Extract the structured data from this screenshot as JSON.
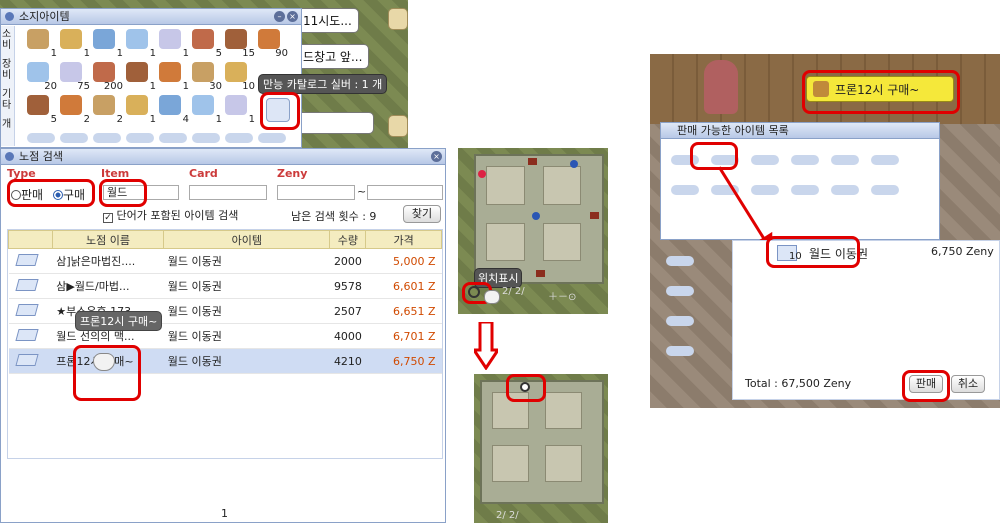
{
  "inventory": {
    "title": "소지아이템",
    "side_tabs": [
      "소비",
      "장비",
      "기타",
      "개"
    ],
    "row1_counts": [
      "1",
      "1",
      "1",
      "1",
      "1",
      "5",
      "15",
      "90"
    ],
    "row2_counts": [
      "20",
      "75",
      "200",
      "1",
      "1",
      "30",
      "10",
      ""
    ],
    "row3_counts": [
      "5",
      "2",
      "2",
      "1",
      "4",
      "1",
      "1",
      ""
    ],
    "tooltip": "만능 카탈로그 실버 : 1 개"
  },
  "bubbles": {
    "b1": "11시도...",
    "b2": "드창고 앞...",
    "b3": ""
  },
  "vending": {
    "title": "노점 검색",
    "labels": {
      "type": "Type",
      "item": "Item",
      "card": "Card",
      "zeny": "Zeny"
    },
    "radio_sell": "판매",
    "radio_buy": "구매",
    "item_value": "월드",
    "tilde": "~",
    "checkbox_label": "단어가 포함된 아이템 검색",
    "remaining": "남은 검색 횟수 : 9",
    "search_button": "찾기",
    "columns": [
      "노점 이름",
      "아이템",
      "수량",
      "가격"
    ],
    "rows": [
      {
        "shop": "삼]낡은마법진....",
        "item": "월드 이동권",
        "qty": "2000",
        "price": "5,000 Z"
      },
      {
        "shop": "삼▶월드/마법...",
        "item": "월드 이동권",
        "qty": "9578",
        "price": "6,601 Z"
      },
      {
        "shop": "★부스유후 173",
        "item": "월드 이동권",
        "qty": "2507",
        "price": "6,651 Z"
      },
      {
        "shop": "월드 선의의 맥...",
        "item": "월드 이동권",
        "qty": "4000",
        "price": "6,701 Z"
      },
      {
        "shop": "프론12시 구매~",
        "item": "월드 이동권",
        "qty": "4210",
        "price": "6,750 Z"
      }
    ],
    "row_tooltip": "프론12시 구매~",
    "page": "1"
  },
  "minimap": {
    "position_label": "위치표시",
    "coords": "2/ 2/"
  },
  "shop": {
    "sign": "프론12시 구매~",
    "window_title": "판매 가능한 아이템 목록",
    "item_count": "10",
    "item_name": "월드 이동권",
    "item_price": "6,750 Zeny",
    "total": "Total : 67,500 Zeny",
    "sell_button": "판매",
    "cancel_button": "취소"
  },
  "colors": {
    "highlight": "#e00000",
    "price": "#d04a00",
    "title_bar": "#b8c8e6"
  }
}
